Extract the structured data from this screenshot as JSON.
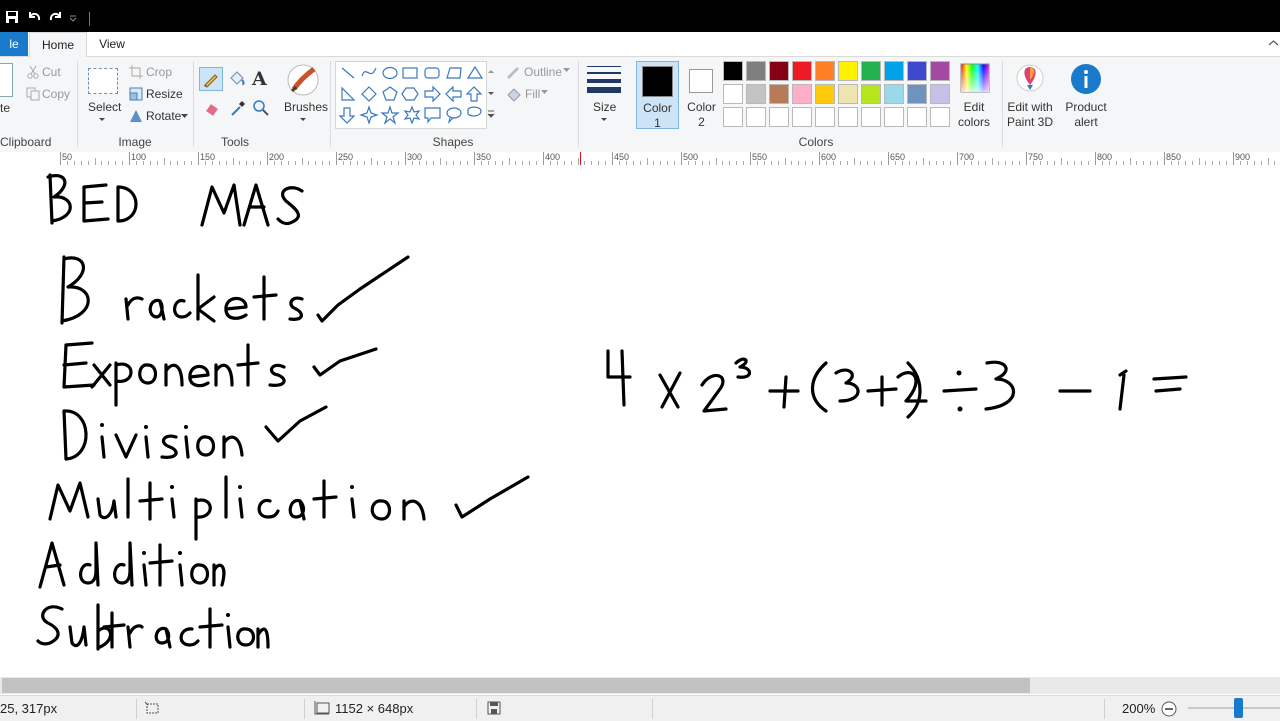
{
  "tabs": {
    "file": "le",
    "home": "Home",
    "view": "View"
  },
  "clipboard": {
    "paste": "te",
    "cut": "Cut",
    "copy": "Copy",
    "group": "Clipboard"
  },
  "image": {
    "select": "Select",
    "crop": "Crop",
    "resize": "Resize",
    "rotate": "Rotate",
    "group": "Image"
  },
  "tools": {
    "group": "Tools",
    "brushes": "Brushes"
  },
  "shapes": {
    "group": "Shapes",
    "outline": "Outline",
    "fill": "Fill"
  },
  "size": {
    "label": "Size"
  },
  "colors": {
    "color1_line1": "Color",
    "color1_line2": "1",
    "color2_line1": "Color",
    "color2_line2": "2",
    "group": "Colors",
    "edit_line1": "Edit",
    "edit_line2": "colors",
    "color1_value": "#000000",
    "color2_value": "#ffffff",
    "palette": [
      "#000000",
      "#7f7f7f",
      "#880015",
      "#ed1c24",
      "#ff7f27",
      "#fff200",
      "#22b14c",
      "#00a2e8",
      "#3f48cc",
      "#a349a4",
      "#ffffff",
      "#c3c3c3",
      "#b97a57",
      "#ffaec9",
      "#ffc90e",
      "#efe4b0",
      "#b5e61d",
      "#99d9ea",
      "#7092be",
      "#c8bfe7"
    ]
  },
  "paint3d": {
    "line1": "Edit with",
    "line2": "Paint 3D"
  },
  "product_alert": {
    "line1": "Product",
    "line2": "alert"
  },
  "ruler": [
    "50",
    "100",
    "150",
    "200",
    "250",
    "300",
    "350",
    "400",
    "450",
    "500",
    "550",
    "600",
    "650",
    "700",
    "750",
    "800",
    "850",
    "900"
  ],
  "status": {
    "cursor": "25, 317px",
    "canvas_size": "1152 × 648px",
    "zoom": "200%"
  }
}
